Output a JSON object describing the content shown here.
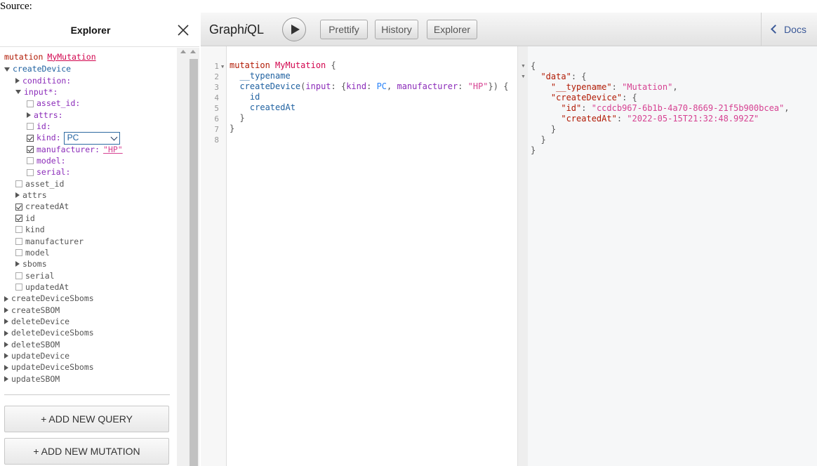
{
  "source_label": "Source:",
  "explorer": {
    "title": "Explorer",
    "operation_keyword": "mutation",
    "operation_name": "MyMutation",
    "tree": [
      {
        "label": "createDevice",
        "kind": "field",
        "marker": "down",
        "indent": 0
      },
      {
        "label": "condition:",
        "kind": "arg",
        "marker": "right",
        "indent": 1
      },
      {
        "label": "input*:",
        "kind": "arg",
        "marker": "down",
        "indent": 1
      },
      {
        "label": "asset_id:",
        "kind": "arg",
        "marker": "checkbox",
        "checked": false,
        "indent": 2
      },
      {
        "label": "attrs:",
        "kind": "arg",
        "marker": "right",
        "indent": 2
      },
      {
        "label": "id:",
        "kind": "arg",
        "marker": "checkbox",
        "checked": false,
        "indent": 2
      },
      {
        "label": "kind:",
        "kind": "arg",
        "marker": "checkbox",
        "checked": true,
        "indent": 2,
        "select_value": "PC"
      },
      {
        "label": "manufacturer:",
        "kind": "arg",
        "marker": "checkbox",
        "checked": true,
        "indent": 2,
        "string_value": "\"HP\""
      },
      {
        "label": "model:",
        "kind": "arg",
        "marker": "checkbox",
        "checked": false,
        "indent": 2
      },
      {
        "label": "serial:",
        "kind": "arg",
        "marker": "checkbox",
        "checked": false,
        "indent": 2
      },
      {
        "label": "asset_id",
        "kind": "plain",
        "marker": "checkbox",
        "checked": false,
        "indent": 1
      },
      {
        "label": "attrs",
        "kind": "plain",
        "marker": "right",
        "indent": 1
      },
      {
        "label": "createdAt",
        "kind": "plain",
        "marker": "checkbox",
        "checked": true,
        "indent": 1
      },
      {
        "label": "id",
        "kind": "plain",
        "marker": "checkbox",
        "checked": true,
        "indent": 1
      },
      {
        "label": "kind",
        "kind": "plain",
        "marker": "checkbox",
        "checked": false,
        "indent": 1
      },
      {
        "label": "manufacturer",
        "kind": "plain",
        "marker": "checkbox",
        "checked": false,
        "indent": 1
      },
      {
        "label": "model",
        "kind": "plain",
        "marker": "checkbox",
        "checked": false,
        "indent": 1
      },
      {
        "label": "sboms",
        "kind": "plain",
        "marker": "right",
        "indent": 1
      },
      {
        "label": "serial",
        "kind": "plain",
        "marker": "checkbox",
        "checked": false,
        "indent": 1
      },
      {
        "label": "updatedAt",
        "kind": "plain",
        "marker": "checkbox",
        "checked": false,
        "indent": 1
      },
      {
        "label": "createDeviceSboms",
        "kind": "plain",
        "marker": "right",
        "indent": 0
      },
      {
        "label": "createSBOM",
        "kind": "plain",
        "marker": "right",
        "indent": 0
      },
      {
        "label": "deleteDevice",
        "kind": "plain",
        "marker": "right",
        "indent": 0
      },
      {
        "label": "deleteDeviceSboms",
        "kind": "plain",
        "marker": "right",
        "indent": 0
      },
      {
        "label": "deleteSBOM",
        "kind": "plain",
        "marker": "right",
        "indent": 0
      },
      {
        "label": "updateDevice",
        "kind": "plain",
        "marker": "right",
        "indent": 0
      },
      {
        "label": "updateDeviceSboms",
        "kind": "plain",
        "marker": "right",
        "indent": 0
      },
      {
        "label": "updateSBOM",
        "kind": "plain",
        "marker": "right",
        "indent": 0
      }
    ],
    "add_query_label": "+ ADD NEW QUERY",
    "add_mutation_label": "+ ADD NEW MUTATION"
  },
  "toolbar": {
    "logo_pre": "Graph",
    "logo_i": "i",
    "logo_post": "QL",
    "prettify_label": "Prettify",
    "history_label": "History",
    "explorer_label": "Explorer",
    "docs_label": "Docs"
  },
  "editor": {
    "line_numbers": [
      "1",
      "2",
      "3",
      "4",
      "5",
      "6",
      "7",
      "8"
    ],
    "lines": [
      [
        {
          "t": "mutation",
          "c": "c-kw"
        },
        {
          "t": " ",
          "c": ""
        },
        {
          "t": "MyMutation",
          "c": "c-def"
        },
        {
          "t": " {",
          "c": "c-punc"
        }
      ],
      [
        {
          "t": "  ",
          "c": ""
        },
        {
          "t": "__typename",
          "c": "c-prop"
        }
      ],
      [
        {
          "t": "  ",
          "c": ""
        },
        {
          "t": "createDevice",
          "c": "c-prop"
        },
        {
          "t": "(",
          "c": "c-punc"
        },
        {
          "t": "input",
          "c": "c-attr"
        },
        {
          "t": ": {",
          "c": "c-punc"
        },
        {
          "t": "kind",
          "c": "c-attr"
        },
        {
          "t": ": ",
          "c": "c-punc"
        },
        {
          "t": "PC",
          "c": "c-num"
        },
        {
          "t": ", ",
          "c": "c-punc"
        },
        {
          "t": "manufacturer",
          "c": "c-attr"
        },
        {
          "t": ": ",
          "c": "c-punc"
        },
        {
          "t": "\"HP\"",
          "c": "c-str"
        },
        {
          "t": "}) {",
          "c": "c-punc"
        }
      ],
      [
        {
          "t": "    ",
          "c": ""
        },
        {
          "t": "id",
          "c": "c-prop"
        }
      ],
      [
        {
          "t": "    ",
          "c": ""
        },
        {
          "t": "createdAt",
          "c": "c-prop"
        }
      ],
      [
        {
          "t": "  }",
          "c": "c-punc"
        }
      ],
      [
        {
          "t": "}",
          "c": "c-punc"
        }
      ],
      [
        {
          "t": "",
          "c": ""
        }
      ]
    ]
  },
  "result": {
    "lines": [
      [
        {
          "t": "{",
          "c": "c-punc"
        }
      ],
      [
        {
          "t": "  ",
          "c": ""
        },
        {
          "t": "\"data\"",
          "c": "c-kw"
        },
        {
          "t": ": {",
          "c": "c-punc"
        }
      ],
      [
        {
          "t": "    ",
          "c": ""
        },
        {
          "t": "\"__typename\"",
          "c": "c-kw"
        },
        {
          "t": ": ",
          "c": "c-punc"
        },
        {
          "t": "\"Mutation\"",
          "c": "c-str"
        },
        {
          "t": ",",
          "c": "c-punc"
        }
      ],
      [
        {
          "t": "    ",
          "c": ""
        },
        {
          "t": "\"createDevice\"",
          "c": "c-kw"
        },
        {
          "t": ": {",
          "c": "c-punc"
        }
      ],
      [
        {
          "t": "      ",
          "c": ""
        },
        {
          "t": "\"id\"",
          "c": "c-kw"
        },
        {
          "t": ": ",
          "c": "c-punc"
        },
        {
          "t": "\"ccdcb967-6b1b-4a70-8669-21f5b900bcea\"",
          "c": "c-str"
        },
        {
          "t": ",",
          "c": "c-punc"
        }
      ],
      [
        {
          "t": "      ",
          "c": ""
        },
        {
          "t": "\"createdAt\"",
          "c": "c-kw"
        },
        {
          "t": ": ",
          "c": "c-punc"
        },
        {
          "t": "\"2022-05-15T21:32:48.992Z\"",
          "c": "c-str"
        }
      ],
      [
        {
          "t": "    }",
          "c": "c-punc"
        }
      ],
      [
        {
          "t": "  }",
          "c": "c-punc"
        }
      ],
      [
        {
          "t": "}",
          "c": "c-punc"
        }
      ]
    ]
  },
  "colors": {
    "keyword": "#b11a04",
    "def": "#d2054e",
    "property": "#1f61a0",
    "attribute": "#8b2bb9",
    "string": "#d64292",
    "docs_link": "#3b5998"
  }
}
